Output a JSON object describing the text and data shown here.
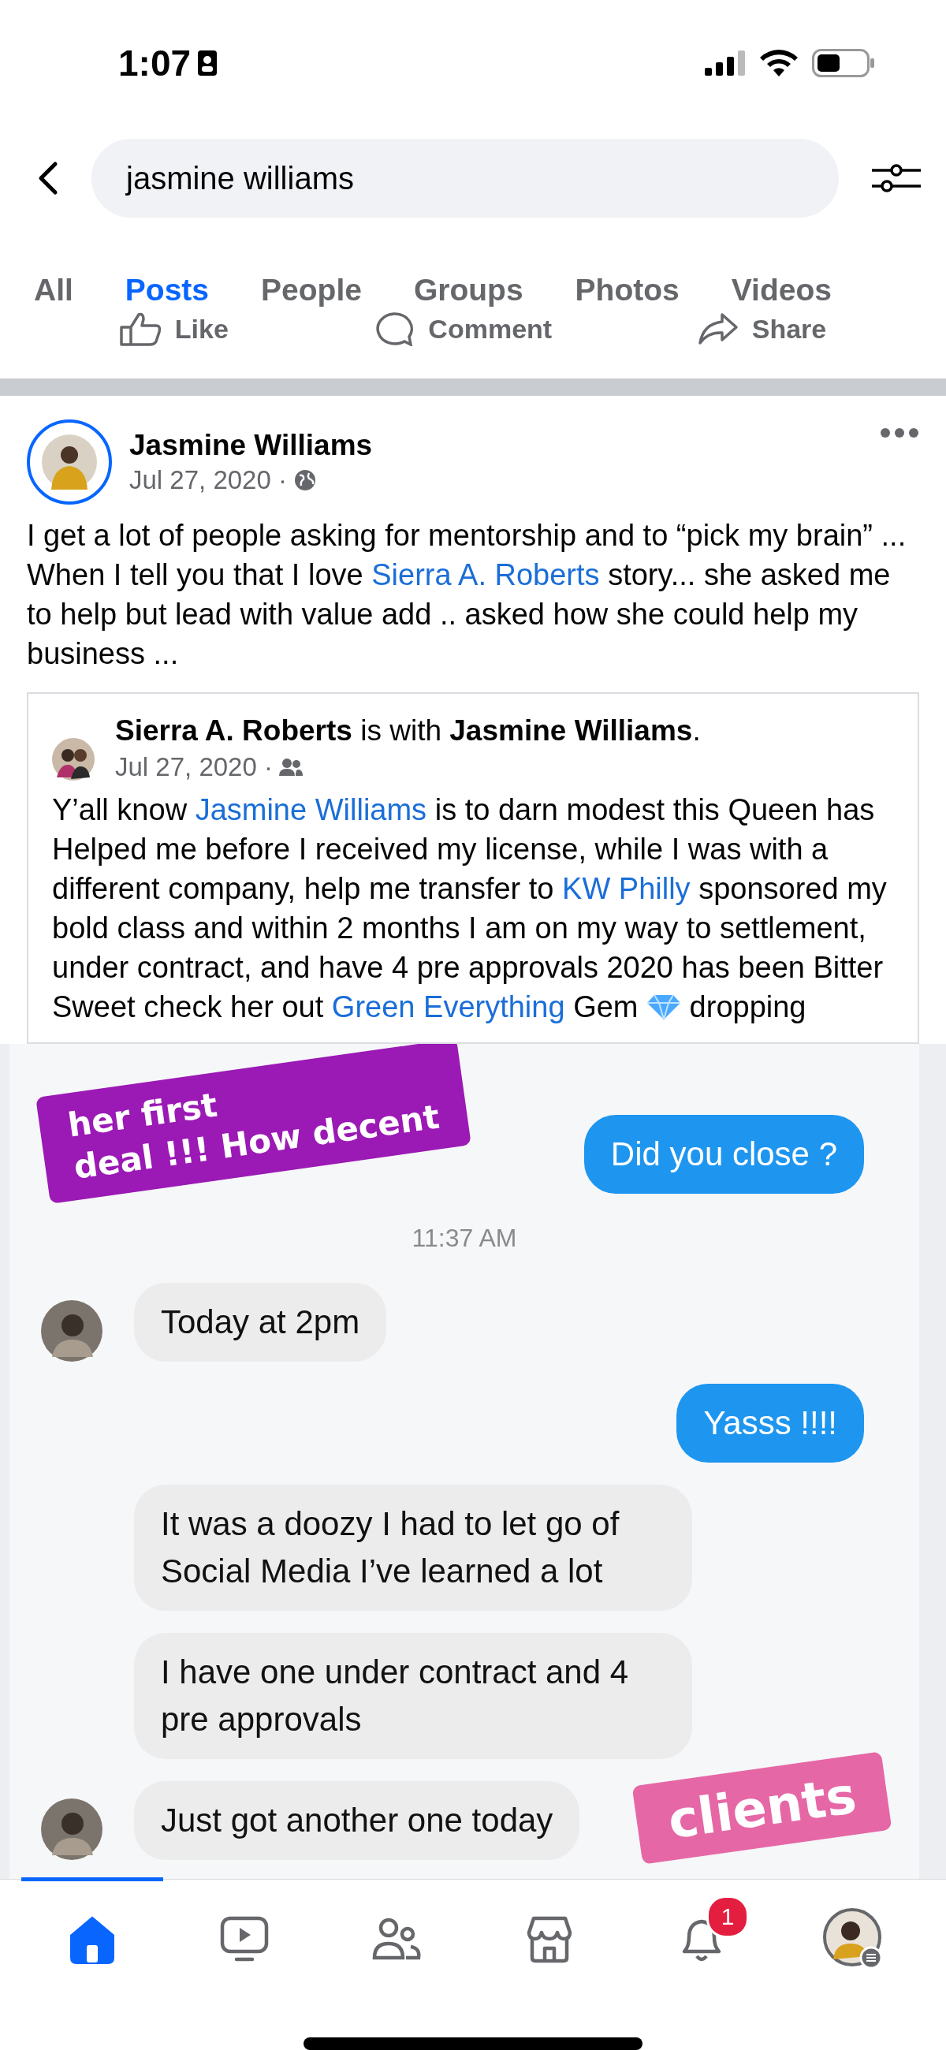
{
  "status_bar": {
    "time": "1:07"
  },
  "search": {
    "value": "jasmine williams"
  },
  "tabs": [
    {
      "label": "All",
      "selected": false
    },
    {
      "label": "Posts",
      "selected": true
    },
    {
      "label": "People",
      "selected": false
    },
    {
      "label": "Groups",
      "selected": false
    },
    {
      "label": "Photos",
      "selected": false
    },
    {
      "label": "Videos",
      "selected": false
    }
  ],
  "actions": [
    {
      "kind": "like",
      "label": "Like"
    },
    {
      "kind": "comment",
      "label": "Comment"
    },
    {
      "kind": "share",
      "label": "Share"
    }
  ],
  "post": {
    "author": "Jasmine Williams",
    "date": "Jul 27, 2020 ·",
    "body": [
      {
        "kind": "text",
        "text": "I get a lot of people asking for mentorship and to “pick my brain” ... When I tell you that I love "
      },
      {
        "kind": "link",
        "text": "Sierra A. Roberts"
      },
      {
        "kind": "text",
        "text": " story... she asked me to help but lead with value add .. asked how she could help my business ..."
      }
    ],
    "shared": {
      "header": "**Sierra A. Roberts** is with **Jasmine Williams**.",
      "date": "Jul 27, 2020 ·",
      "body": [
        {
          "kind": "text",
          "text": "Y’all know "
        },
        {
          "kind": "link",
          "text": "Jasmine Williams"
        },
        {
          "kind": "text",
          "text": " is to darn modest this Queen has Helped me before I received my license, while I was with a different company, help me transfer to "
        },
        {
          "kind": "link",
          "text": "KW Philly"
        },
        {
          "kind": "text",
          "text": "  sponsored my bold class and within 2 months I am on my way to settlement, under contract, and have 4 pre approvals 2020 has been Bitter Sweet check her out "
        },
        {
          "kind": "link",
          "text": "Green Everything"
        },
        {
          "kind": "text",
          "text": " Gem "
        },
        {
          "kind": "gem"
        },
        {
          "kind": "text",
          "text": " dropping"
        }
      ]
    }
  },
  "chat": {
    "banners": [
      {
        "kind": "top",
        "lines": [
          "her first",
          "deal !!! How decent"
        ]
      },
      {
        "kind": "bottom",
        "lines": [
          "clients"
        ]
      }
    ],
    "messages": [
      {
        "kind": "sent",
        "text": "Did you close ?"
      },
      {
        "kind": "time",
        "text": "11:37 AM"
      },
      {
        "kind": "received",
        "text": "Today at 2pm",
        "avatar": true
      },
      {
        "kind": "sent",
        "text": "Yasss !!!!"
      },
      {
        "kind": "received",
        "text": "It was a doozy I had to let go of Social Media I’ve learned a lot",
        "avatar": false
      },
      {
        "kind": "received",
        "text": "I have one under contract and 4 pre approvals",
        "avatar": false
      },
      {
        "kind": "received",
        "text": "Just got another one today",
        "avatar": true
      }
    ]
  },
  "nav": [
    {
      "kind": "home",
      "selected": true
    },
    {
      "kind": "video",
      "selected": false
    },
    {
      "kind": "friends",
      "selected": false
    },
    {
      "kind": "market",
      "selected": false
    },
    {
      "kind": "bell",
      "selected": false,
      "badge": "1"
    },
    {
      "kind": "profile",
      "selected": false
    }
  ]
}
